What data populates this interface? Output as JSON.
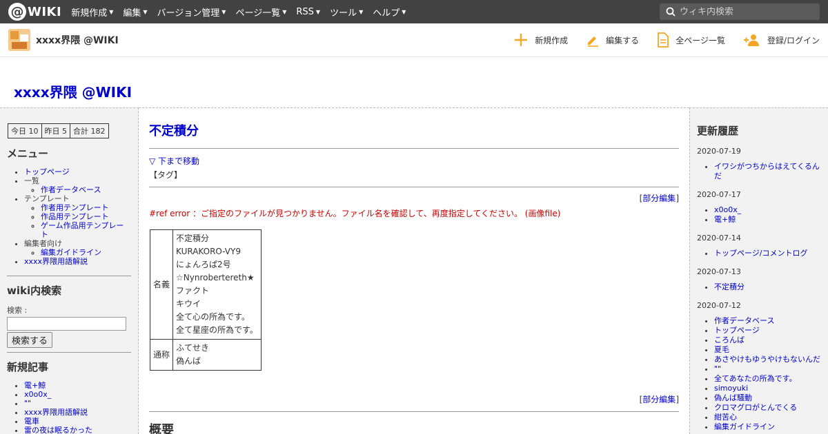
{
  "topbar": {
    "logo_text": "WIKI",
    "menu": [
      "新規作成",
      "編集",
      "バージョン管理",
      "ページ一覧",
      "RSS",
      "ツール",
      "ヘルプ"
    ],
    "search_placeholder": "ウィキ内検索"
  },
  "header": {
    "site_name": "xxxx界隈 @WIKI",
    "actions": [
      {
        "label": "新規作成",
        "icon": "plus-icon"
      },
      {
        "label": "編集する",
        "icon": "pencil-icon"
      },
      {
        "label": "全ページ一覧",
        "icon": "document-icon"
      },
      {
        "label": "登録/ログイン",
        "icon": "add-user-icon"
      }
    ]
  },
  "wiki_title": "xxxx界隈 @WIKI",
  "left": {
    "counter": [
      "今日 10",
      "昨日 5",
      "合計 182"
    ],
    "menu_heading": "メニュー",
    "menu": [
      {
        "label": "トップページ",
        "link": true,
        "children": []
      },
      {
        "label": "一覧",
        "link": false,
        "children": [
          "作者データベース"
        ]
      },
      {
        "label": "テンプレート",
        "link": false,
        "children": [
          "作者用テンプレート",
          "作品用テンプレート",
          "ゲーム作品用テンプレート"
        ]
      },
      {
        "label": "編集者向け",
        "link": false,
        "children": [
          "編集ガイドライン"
        ]
      },
      {
        "label": "xxxx界隈用語解説",
        "link": true,
        "children": []
      }
    ],
    "search_heading": "wiki内検索",
    "search_label": "検索 :",
    "search_button": "検索する",
    "new_heading": "新規記事",
    "new_items": [
      "電+鯨",
      "x0o0x_",
      "\"\"",
      "xxxx界隈用語解説",
      "電車",
      "雷の夜は眠るかった"
    ]
  },
  "main": {
    "title": "不定積分",
    "jump": "▽ 下まで移動",
    "tag": "【タグ】",
    "partedit_open": "[",
    "partedit_label": "部分編集",
    "partedit_close": "]",
    "error": "#ref error ：ご指定のファイルが見つかりません。ファイル名を確認して、再度指定してください。 (画像file)",
    "table": {
      "name_key": "名義",
      "names": [
        "不定積分",
        "KURAKORO-VY9",
        "にょんろぱ2号",
        "☆Nynrobertereth★",
        "ファクト",
        "キウイ",
        "全て心の所為です。",
        "全て星座の所為です。"
      ],
      "alias_key": "通称",
      "aliases": [
        "ふてせき",
        "偽んば"
      ]
    },
    "section_title": "概要"
  },
  "right": {
    "heading": "更新履歴",
    "groups": [
      {
        "date": "2020-07-19",
        "items": [
          "イワシがつちからはえてくるんだ"
        ]
      },
      {
        "date": "2020-07-17",
        "items": [
          "x0o0x_",
          "電+鯨"
        ]
      },
      {
        "date": "2020-07-14",
        "items": [
          "トップページ/コメントログ"
        ]
      },
      {
        "date": "2020-07-13",
        "items": [
          "不定積分"
        ]
      },
      {
        "date": "2020-07-12",
        "items": [
          "作者データベース",
          "トップページ",
          "ころんば",
          "夏毛",
          "あさやけもゆうやけもないんだ",
          "\"\"",
          "全てあなたの所為です。",
          "simoyuki",
          "偽んば騒動",
          "クロマグロがとんでくる",
          "紺苦心",
          "編集ガイドライン"
        ]
      }
    ]
  },
  "colors": {
    "topbar": "#424242",
    "link": "#0000cc",
    "error": "#cc0000",
    "accent": "#f5a623"
  }
}
